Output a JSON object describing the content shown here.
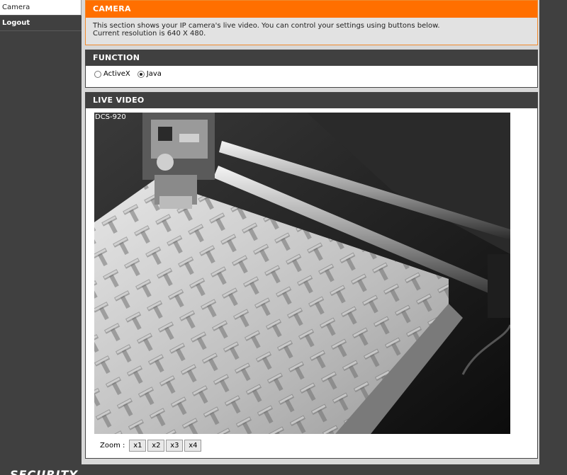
{
  "sidebar": {
    "items": [
      {
        "label": "Camera",
        "active": true
      },
      {
        "label": "Logout",
        "active": false
      }
    ]
  },
  "camera_section": {
    "title": "CAMERA",
    "desc_line1": "This section shows your IP camera's live video. You can control your settings using buttons below.",
    "desc_line2": "Current resolution is 640 X 480."
  },
  "function_section": {
    "title": "FUNCTION",
    "options": [
      {
        "label": "ActiveX",
        "selected": false
      },
      {
        "label": "Java",
        "selected": true
      }
    ]
  },
  "live_video": {
    "title": "LIVE VIDEO",
    "camera_name": "DCS-920",
    "zoom_label": "Zoom :",
    "zoom_buttons": [
      "x1",
      "x2",
      "x3",
      "x4"
    ]
  },
  "footer": {
    "brand": "SECURITY"
  },
  "colors": {
    "accent_orange": "#ff6f00",
    "dark_header": "#404040",
    "panel_bg": "#d8d8d8"
  }
}
